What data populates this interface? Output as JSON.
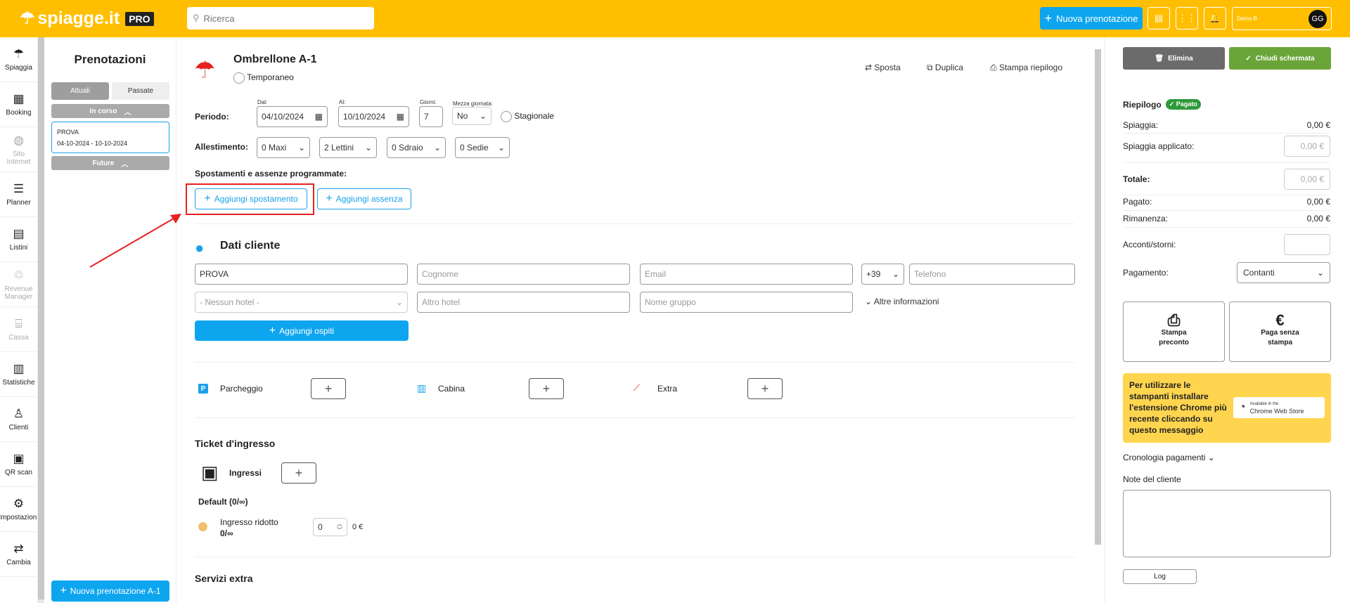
{
  "topbar": {
    "logo": "spiagge.it",
    "pro_badge": "PRO",
    "search_placeholder": "Ricerca",
    "new_booking_label": "Nuova prenotazione",
    "user_name": "Demo B",
    "user_initials": "GG"
  },
  "sidenav": {
    "items": [
      {
        "label": "Spiaggia",
        "icon": "umbrella-icon",
        "enabled": true
      },
      {
        "label": "Booking",
        "icon": "calendar-icon",
        "enabled": true
      },
      {
        "label": "Sito Internet",
        "icon": "globe-icon",
        "enabled": false
      },
      {
        "label": "Planner",
        "icon": "planner-icon",
        "enabled": true
      },
      {
        "label": "Listini",
        "icon": "list-icon",
        "enabled": true
      },
      {
        "label": "Revenue Manager",
        "icon": "revenue-icon",
        "enabled": false
      },
      {
        "label": "Cassa",
        "icon": "register-icon",
        "enabled": false
      },
      {
        "label": "Statistiche",
        "icon": "chart-icon",
        "enabled": true
      },
      {
        "label": "Clienti",
        "icon": "user-icon",
        "enabled": true
      },
      {
        "label": "QR scan",
        "icon": "qr-icon",
        "enabled": true
      },
      {
        "label": "Impostazioni",
        "icon": "gear-icon",
        "enabled": true
      },
      {
        "label": "Cambia",
        "icon": "swap-icon",
        "enabled": true
      }
    ]
  },
  "bookings": {
    "title": "Prenotazioni",
    "tab_current": "Attuali",
    "tab_past": "Passate",
    "group_current": "In corso",
    "group_future": "Future",
    "card_name": "PROVA",
    "card_dates": "04-10-2024 - 10-10-2024",
    "new_button": "Nuova prenotazione A-1"
  },
  "booking": {
    "title": "Ombrellone A-1",
    "temporary_label": "Temporaneo",
    "move_label": "Sposta",
    "duplicate_label": "Duplica",
    "print_label": "Stampa riepilogo",
    "period_label": "Periodo:",
    "from_label": "Dal:",
    "from_value": "04/10/2024",
    "to_label": "Al:",
    "to_value": "10/10/2024",
    "days_label": "Giorni:",
    "days_value": "7",
    "half_day_label": "Mezza giornata:",
    "half_day_value": "No",
    "seasonal_label": "Stagionale",
    "setup_label": "Allestimento:",
    "setup": [
      "0 Maxi",
      "2 Lettini",
      "0 Sdraio",
      "0 Sedie"
    ],
    "scheduled_label": "Spostamenti e assenze programmate:",
    "add_move": "Aggiungi spostamento",
    "add_absence": "Aggiungi assenza"
  },
  "customer": {
    "title": "Dati cliente",
    "name_value": "PROVA",
    "surname_placeholder": "Cognome",
    "email_placeholder": "Email",
    "prefix": "+39",
    "phone_placeholder": "Telefono",
    "hotel_placeholder": "- Nessun hotel -",
    "other_hotel_placeholder": "Altro hotel",
    "group_placeholder": "Nome gruppo",
    "more_info": "Altre informazioni",
    "add_guests": "Aggiungi ospiti"
  },
  "extras": {
    "parking": "Parcheggio",
    "cabin": "Cabina",
    "extra": "Extra"
  },
  "tickets": {
    "title": "Ticket d'ingresso",
    "entries": "Ingressi",
    "default": "Default (0/∞)",
    "reduced": "Ingresso ridotto",
    "reduced_count": "0/∞",
    "reduced_qty": "0",
    "reduced_price": "0 €",
    "extra_services": "Servizi extra"
  },
  "summary": {
    "delete": "Elimina",
    "close": "Chiudi schermata",
    "title": "Riepilogo",
    "paid_badge": "Pagato",
    "beach": "Spiaggia:",
    "beach_value": "0,00 €",
    "beach_applied": "Spiaggia applicato:",
    "beach_applied_placeholder": "0,00 €",
    "total": "Totale:",
    "total_placeholder": "0,00 €",
    "paid": "Pagato:",
    "paid_value": "0,00 €",
    "remaining": "Rimanenza:",
    "remaining_value": "0,00 €",
    "deposits": "Acconti/storni:",
    "payment": "Pagamento:",
    "payment_value": "Contanti",
    "print_preaccount": "Stampa preconto",
    "pay_no_print": "Paga senza stampa",
    "printer_note": "Per utilizzare le stampanti installare l'estensione Chrome più recente cliccando su questo messaggio",
    "cws_small": "Available in the",
    "cws_big": "Chrome Web Store",
    "history": "Cronologia pagamenti",
    "notes": "Note del cliente",
    "log": "Log"
  },
  "colors": {
    "brand": "#ffbf00",
    "accent": "#0ea5ef",
    "success": "#6aa53a",
    "danger": "#e52222"
  }
}
